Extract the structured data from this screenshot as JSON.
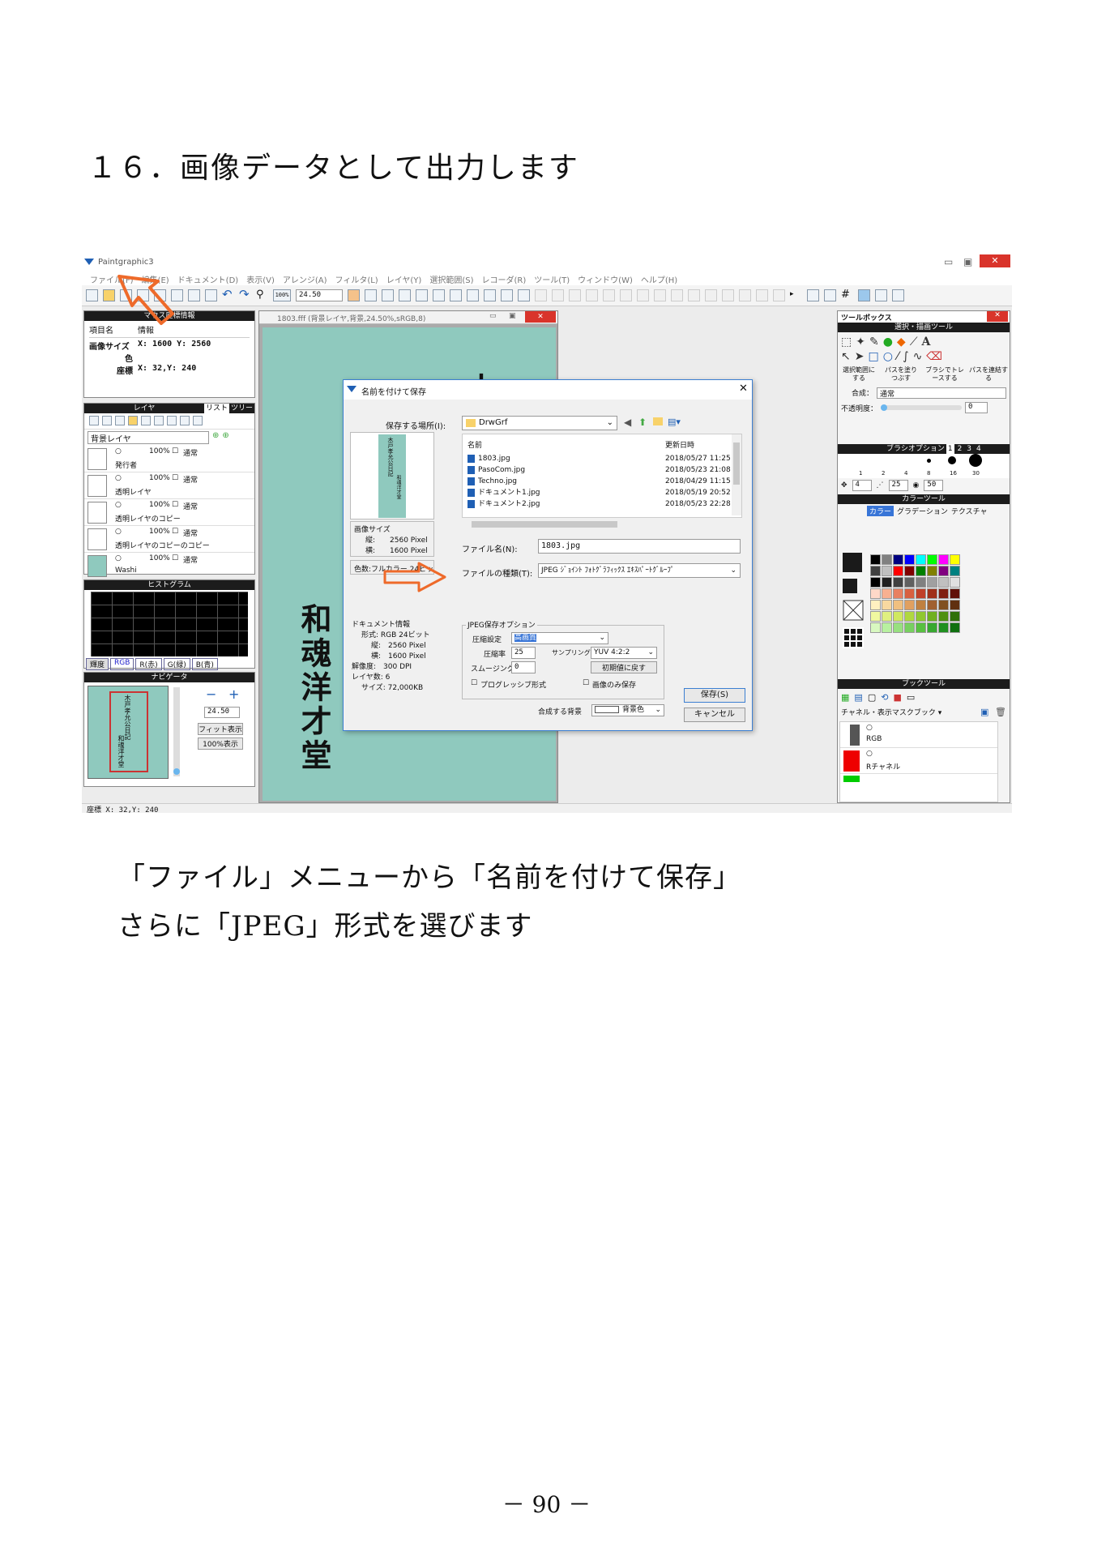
{
  "heading": "１６．画像データとして出力します",
  "captions": [
    "「ファイル」メニューから「名前を付けて保存」",
    "さらに「JPEG」形式を選びます"
  ],
  "page_number": "－ 90 －",
  "app": {
    "title": "Paintgraphic3",
    "menu": [
      "ファイル(F)",
      "編集(E)",
      "ドキュメント(D)",
      "表示(V)",
      "アレンジ(A)",
      "フィルタ(L)",
      "レイヤ(Y)",
      "選択範囲(S)",
      "レコーダ(R)",
      "ツール(T)",
      "ウィンドウ(W)",
      "ヘルプ(H)"
    ],
    "zoom_value": "24.50",
    "zoom_100": "100%",
    "status": "座標 X: 32,Y: 240"
  },
  "info_panel": {
    "title": "マウス座標情報",
    "col1": "項目名",
    "col2": "情報",
    "rows": [
      [
        "画像サイズ",
        "X: 1600 Y: 2560"
      ],
      [
        "色",
        ""
      ],
      [
        "座標",
        "X: 32,Y: 240"
      ]
    ]
  },
  "layer_panel": {
    "title": "レイヤ",
    "tab2": "リスト",
    "tab3": "ツリー",
    "current": "背景レイヤ",
    "layers": [
      {
        "opacity": "100%",
        "mode": "通常",
        "name": "発行者"
      },
      {
        "opacity": "100%",
        "mode": "通常",
        "name": "透明レイヤ"
      },
      {
        "opacity": "100%",
        "mode": "通常",
        "name": "透明レイヤのコピー"
      },
      {
        "opacity": "100%",
        "mode": "通常",
        "name": "透明レイヤのコピーのコピー"
      },
      {
        "opacity": "100%",
        "mode": "通常",
        "name": "Washi"
      }
    ]
  },
  "histogram": {
    "title": "ヒストグラム",
    "tabs": [
      "輝度",
      "RGB",
      "R(赤)",
      "G(緑)",
      "B(青)"
    ]
  },
  "navigator": {
    "title": "ナビゲータ",
    "zoom": "24.50",
    "fit": "フィット表示",
    "full": "100%表示",
    "preview_text": "木戸孝允公日記",
    "preview_text2": "和魂洋才堂"
  },
  "document": {
    "title": "1803.fff (背景レイヤ,背景,24.50%,sRGB,8)",
    "vertical_text": "和魂洋才堂",
    "top_char": "木"
  },
  "dialog": {
    "title": "名前を付けて保存",
    "location_label": "保存する場所(I):",
    "location": "DrwGrf",
    "col_name": "名前",
    "col_date": "更新日時",
    "files": [
      {
        "name": "1803.jpg",
        "date": "2018/05/27 11:25"
      },
      {
        "name": "PasoCom.jpg",
        "date": "2018/05/23 21:08"
      },
      {
        "name": "Techno.jpg",
        "date": "2018/04/29 11:15"
      },
      {
        "name": "ドキュメント1.jpg",
        "date": "2018/05/19 20:52"
      },
      {
        "name": "ドキュメント2.jpg",
        "date": "2018/05/23 22:28"
      }
    ],
    "filename_label": "ファイル名(N):",
    "filename": "1803.jpg",
    "filetype_label": "ファイルの種類(T):",
    "filetype": "JPEG ｼﾞｮｲﾝﾄ ﾌｫﾄｸﾞﾗﾌｨｯｸｽ ｴｷｽﾊﾟｰﾄｸﾞﾙｰﾌﾟ",
    "image_size_title": "画像サイズ",
    "height": "縦:　　2560 Pixel",
    "width": "横:　　1600 Pixel",
    "color_mode": "色数:フルカラー 24ビット",
    "preview_text": "木戸孝允公日記",
    "preview_text2": "和魂洋才堂",
    "doc_info_title": "ドキュメント情報",
    "doc_info": [
      "形式: RGB 24ビット",
      "縦:　2560 Pixel",
      "横:　1600 Pixel",
      "解像度:　300 DPI",
      "レイヤ数: 6",
      "サイズ: 72,000KB"
    ],
    "jpeg_title": "JPEG保存オプション",
    "compress_setting_label": "圧縮設定",
    "compress_setting": "高画質",
    "compress_rate_label": "圧縮率",
    "compress_rate": "25",
    "sampling_label": "サンプリング",
    "sampling": "YUV 4:2:2",
    "smoothing_label": "スムージング",
    "smoothing": "0",
    "reset": "初期値に戻す",
    "progressive": "プログレッシブ形式",
    "image_only": "画像のみ保存",
    "bg_label": "合成する背景",
    "bg_value": "背景色",
    "save": "保存(S)",
    "cancel": "キャンセル"
  },
  "toolbox": {
    "title": "ツールボックス",
    "section": "選択・描画ツール",
    "labels": [
      "選択範囲にする",
      "パスを塗りつぶす",
      "ブラシでトレースする",
      "パスを連結する"
    ],
    "blend_label": "合成：",
    "blend": "通常",
    "opacity_label": "不透明度：",
    "opacity": "0",
    "brush_title": "ブラシオプション",
    "brush_tabs": [
      "1",
      "2",
      "3",
      "4"
    ],
    "brush_sizes": [
      "1",
      "2",
      "4",
      "8",
      "16",
      "30"
    ],
    "brush_values": [
      "4",
      "25",
      "50"
    ],
    "color_title": "カラーツール",
    "color_tabs": [
      "カラー",
      "グラデーション",
      "テクスチャ"
    ],
    "swatches": [
      "#000000",
      "#808080",
      "#000080",
      "#0000ff",
      "#00ffff",
      "#00ff00",
      "#ff00ff",
      "#ffff00",
      "#404040",
      "#c0c0c0",
      "#ff0000",
      "#800000",
      "#008000",
      "#808000",
      "#800080",
      "#008080",
      "#000000",
      "#202020",
      "#404040",
      "#606060",
      "#808080",
      "#a0a0a0",
      "#c0c0c0",
      "#e0e0e0",
      "#ffd8c8",
      "#f8b090",
      "#e88060",
      "#d86040",
      "#c04028",
      "#a03018",
      "#802010",
      "#601008",
      "#fff0c0",
      "#f8d8a0",
      "#f0c080",
      "#e0a060",
      "#c08040",
      "#a06030",
      "#805020",
      "#603010",
      "#f0f8a0",
      "#e0f080",
      "#d0e860",
      "#b0d840",
      "#90c830",
      "#70b020",
      "#509010",
      "#307008",
      "#d8f8c0",
      "#b8f0a0",
      "#98e080",
      "#78d060",
      "#58c040",
      "#38a830",
      "#209020",
      "#107010"
    ],
    "book_title": "ブックツール",
    "channel_label": "チャネル・表示マスクブック",
    "channels": [
      "RGB",
      "Rチャネル"
    ]
  },
  "colors": {
    "accent_orange": "#ee6a2a",
    "document_green": "#8fc9be",
    "dialog_border": "#3c7fd1",
    "title_blue": "#1f5fb4"
  }
}
